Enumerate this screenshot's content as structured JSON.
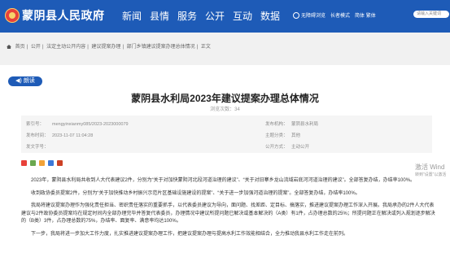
{
  "header": {
    "site_title": "蒙阴县人民政府",
    "nav": [
      "新闻",
      "县情",
      "服务",
      "公开",
      "互动",
      "数据"
    ],
    "toolbar": {
      "accessible": "无障碍浏览",
      "elderly": "长者模式",
      "lang": "简体 繁体",
      "search_placeholder": "请输入关键词"
    }
  },
  "breadcrumb": [
    "首页",
    "公开",
    "法定主动公开内容",
    "建议提案办理",
    "部门乡镇建议提案办理总体情况",
    "正文"
  ],
  "read_button": "朗读",
  "article": {
    "title": "蒙阴县水利局2023年建议提案办理总体情况",
    "views": "浏览次数：34",
    "meta": {
      "index_label": "索引号：",
      "index_value": "mengyinxianmy085/2023-2023000079",
      "pub_org_label": "发布机构：",
      "pub_org_value": "蒙阴县水利局",
      "date_label": "发布时间：",
      "date_value": "2023-11-07 11:04:28",
      "topic_label": "主题分类：",
      "topic_value": "其他",
      "doc_label": "发文字号：",
      "doc_value": "",
      "scope_label": "公开方式：",
      "scope_value": "主动公开"
    },
    "paragraphs": [
      "2023年，蒙阴县水利局共收到人大代表建议2件，分别为“关于对加快蒙阴河北段河道治理的建议”、“关于对旧寨乡龙山流域岩底河河道治理的建议”。全部答复办结，办结率100%。",
      "收到政协委员提案2件，分别为“关于加快推动乡村振兴示范片区基础设施建设的提案”、“关于进一步加强河道治理的提案”。全部答复办结，办结率100%。",
      "我局将建议提案办理作为强化责任担当、密织责任落实的重要抓手，以代表委员建议为导向，面问题、找差距、定目标、搞落实，推进建议提案办理工作深入开展。我局承办的2件人大代表建议与2件政协委员提案均在规定时间内全部办理完毕并答复代表委员，办理情况中建议所提问题已解决或基本解决的（A类）有1件，占办理总数的25%；所提问题正在解决或列入规划逐步解决的（B类）3件，占办理总数的75%，办结率、面复率、满意率均达100%。",
      "下一步，我局将进一步加大工作力度，扎实推进建议提案办理工作，把建议提案办理与提高水利工作效能相结合，全力推动我县水利工作走在前列。"
    ]
  },
  "watermark": {
    "line1": "激活 Wind",
    "line2": "转到“设置”以激活"
  },
  "colors": {
    "brand": "#1e5bb7",
    "share": [
      "#e8413a",
      "#6aa84f",
      "#f1a238",
      "#3c78d8",
      "#cc4125"
    ]
  }
}
